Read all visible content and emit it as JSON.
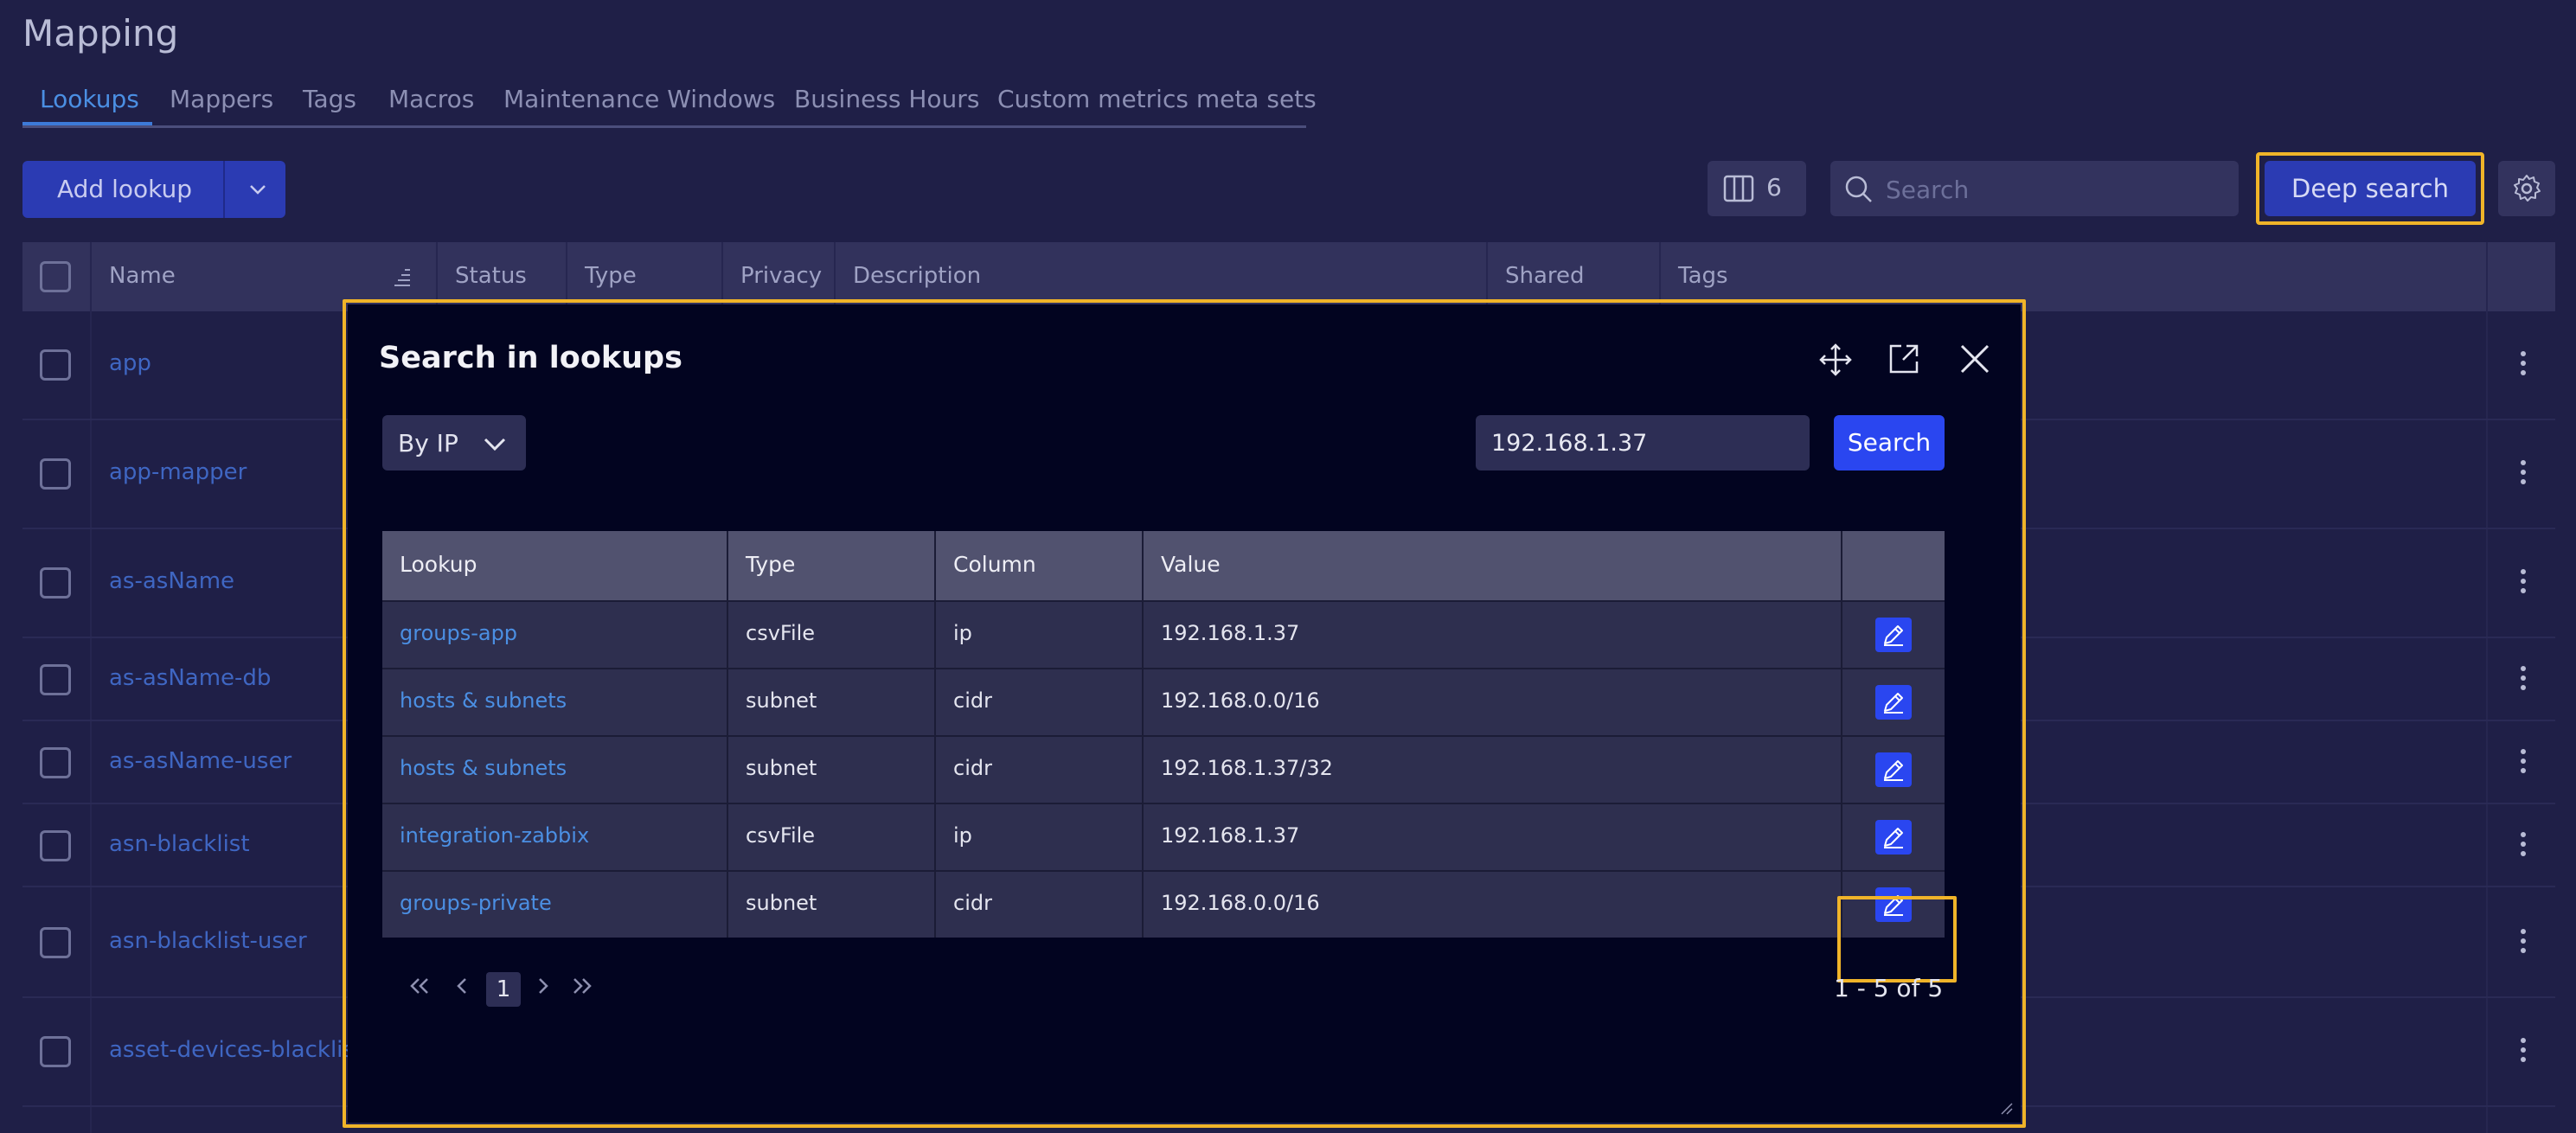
{
  "page": {
    "title": "Mapping"
  },
  "tabs": [
    {
      "label": "Lookups",
      "active": true
    },
    {
      "label": "Mappers"
    },
    {
      "label": "Tags"
    },
    {
      "label": "Macros"
    },
    {
      "label": "Maintenance Windows"
    },
    {
      "label": "Business Hours"
    },
    {
      "label": "Custom metrics meta sets"
    }
  ],
  "toolbar": {
    "add_label": "Add lookup",
    "columns_count": "6",
    "search_placeholder": "Search",
    "deep_search_label": "Deep search"
  },
  "table": {
    "columns": [
      "Name",
      "Status",
      "Type",
      "Privacy",
      "Description",
      "Shared",
      "Tags"
    ],
    "rows": [
      "app",
      "app-mapper",
      "as-asName",
      "as-asName-db",
      "as-asName-user",
      "asn-blacklist",
      "asn-blacklist-user",
      "asset-devices-blacklist"
    ]
  },
  "modal": {
    "title": "Search in lookups",
    "mode": "By IP",
    "query": "192.168.1.37",
    "search_label": "Search",
    "columns": [
      "Lookup",
      "Type",
      "Column",
      "Value"
    ],
    "results": [
      {
        "lookup": "groups-app",
        "type": "csvFile",
        "column": "ip",
        "value": "192.168.1.37"
      },
      {
        "lookup": "hosts & subnets",
        "type": "subnet",
        "column": "cidr",
        "value": "192.168.0.0/16"
      },
      {
        "lookup": "hosts & subnets",
        "type": "subnet",
        "column": "cidr",
        "value": "192.168.1.37/32"
      },
      {
        "lookup": "integration-zabbix",
        "type": "csvFile",
        "column": "ip",
        "value": "192.168.1.37"
      },
      {
        "lookup": "groups-private",
        "type": "subnet",
        "column": "cidr",
        "value": "192.168.0.0/16"
      }
    ],
    "pagination": {
      "current_page": "1",
      "summary": "1 - 5 of 5"
    }
  },
  "colors": {
    "accent": "#2a46f0",
    "highlight": "#f0b429",
    "link": "#4b8fe3"
  }
}
